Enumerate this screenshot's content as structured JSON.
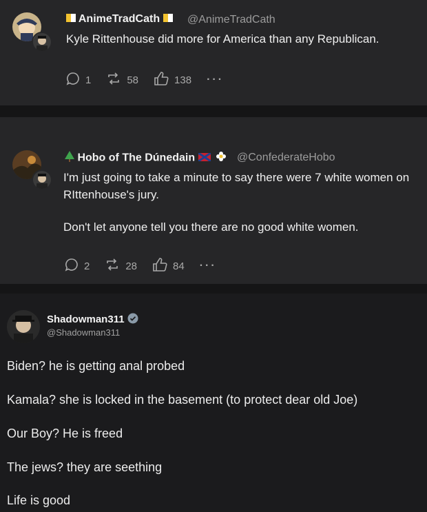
{
  "post1": {
    "name": "AnimeTradCath",
    "handle": "@AnimeTradCath",
    "text": "Kyle Rittenhouse did more for America than any Republican.",
    "replies": "1",
    "reposts": "58",
    "likes": "138",
    "more": "···"
  },
  "post2": {
    "name": "Hobo of The Dúnedain",
    "handle": "@ConfederateHobo",
    "text_line1": "I'm just going to take a minute to say there were 7 white women on",
    "text_line2": "RIttenhouse's jury.",
    "text_line3": "Don't let anyone tell you there are no good white women.",
    "replies": "2",
    "reposts": "28",
    "likes": "84",
    "more": "···"
  },
  "post3": {
    "name": "Shadowman311",
    "handle": "@Shadowman311",
    "lines": [
      "Biden? he is getting anal probed",
      "Kamala? she is locked in the basement (to protect dear old Joe)",
      "Our Boy? He is freed",
      "The jews? they are seething",
      "Life is good"
    ]
  },
  "colors": {
    "verified": "#8a9aa8",
    "tree": "#3fa34d"
  },
  "icons": [
    "reply-icon",
    "repost-icon",
    "like-icon",
    "verified-badge-icon",
    "tree-emoji-icon",
    "flag-icon",
    "flower-emoji-icon"
  ]
}
